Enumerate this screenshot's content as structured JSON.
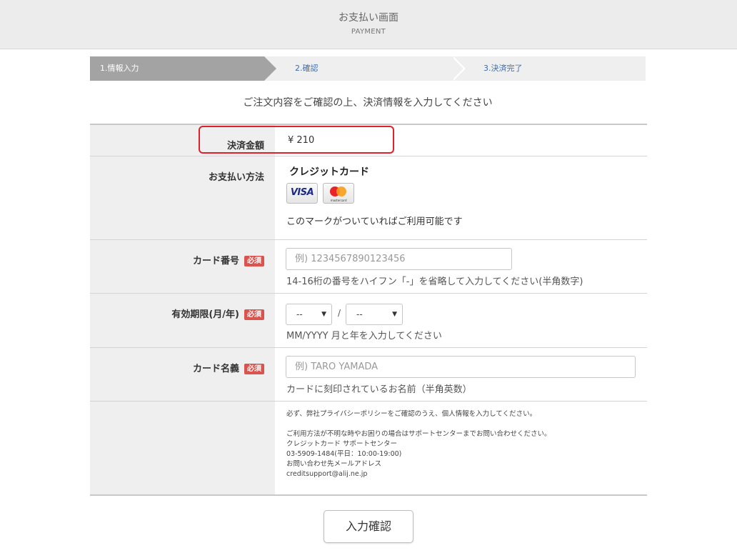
{
  "header": {
    "title": "お支払い画面",
    "subtitle": "PAYMENT"
  },
  "steps": [
    {
      "label": "1.情報入力",
      "active": true
    },
    {
      "label": "2.確認",
      "active": false
    },
    {
      "label": "3.決済完了",
      "active": false
    }
  ],
  "intro": "ご注文内容をご確認の上、決済情報を入力してください",
  "required_badge": "必須",
  "amount": {
    "label": "決済金額",
    "value": "¥ 210"
  },
  "payment_method": {
    "label": "お支払い方法",
    "name": "クレジットカード",
    "cards": [
      "VISA",
      "mastercard"
    ],
    "note": "このマークがついていればご利用可能です"
  },
  "card_number": {
    "label": "カード番号",
    "placeholder": "例) 1234567890123456",
    "help": "14-16桁の番号をハイフン「-」を省略して入力してください(半角数字)"
  },
  "expiry": {
    "label": "有効期限(月/年)",
    "month": "--",
    "year": "--",
    "separator": "/",
    "help": "MM/YYYY 月と年を入力してください"
  },
  "card_name": {
    "label": "カード名義",
    "placeholder": "例) TARO YAMADA",
    "help": "カードに刻印されているお名前（半角英数）"
  },
  "notes": {
    "line1": "必ず、弊社プライバシーポリシーをご確認のうえ、個人情報を入力してください。",
    "line2": "ご利用方法が不明な時やお困りの場合はサポートセンターまでお問い合わせください。",
    "line3": "クレジットカード サポートセンター",
    "line4": "03-5909-1484(平日：10:00-19:00)",
    "line5": "お問い合わせ先メールアドレス",
    "line6": "creditsupport@alij.ne.jp"
  },
  "submit_label": "入力確認",
  "colors": {
    "required": "#d9534f",
    "highlight": "#e0202a",
    "step_active": "#a3a3a3",
    "link": "#3a6fb0"
  }
}
